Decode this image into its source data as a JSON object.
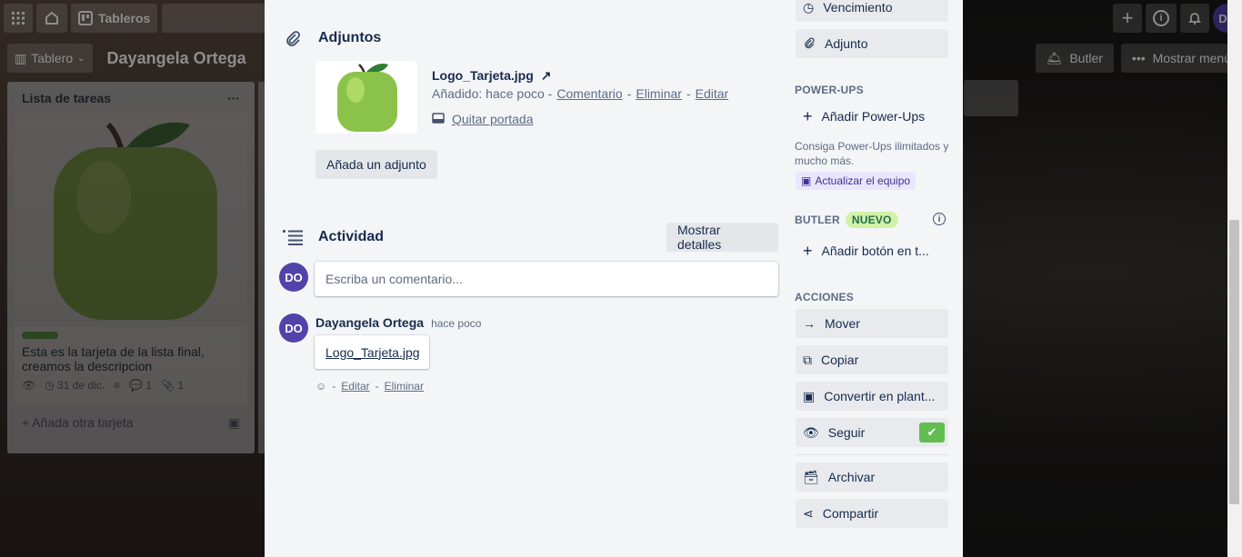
{
  "topbar": {
    "boards_label": "Tableros",
    "user_initials": "DO"
  },
  "boardbar": {
    "view_label": "Tablero",
    "board_title": "Dayangela Ortega",
    "butler_label": "Butler",
    "menu_label": "Mostrar menú"
  },
  "list": {
    "title": "Lista de tareas",
    "card": {
      "text": "Esta es la tarjeta de la lista final, creamos la descripcion",
      "due": "31 de dic.",
      "comments": "1",
      "attachments": "1"
    },
    "add_card": "Añada otra tarjeta"
  },
  "attachments": {
    "heading": "Adjuntos",
    "file_name": "Logo_Tarjeta.jpg",
    "arrow": "↗",
    "added_prefix": "Añadido: hace poco -",
    "comment_link": "Comentario",
    "delete_link": "Eliminar",
    "edit_link": "Editar",
    "sep": "-",
    "remove_cover": "Quitar portada",
    "add_button": "Añada un adjunto"
  },
  "activity": {
    "heading": "Actividad",
    "show_details": "Mostrar detalles",
    "comment_placeholder": "Escriba un comentario...",
    "avatar_initials": "DO",
    "entry": {
      "author": "Dayangela Ortega",
      "time": "hace poco",
      "attachment_link": "Logo_Tarjeta.jpg",
      "dash": "-",
      "edit": "Editar",
      "delete": "Eliminar"
    }
  },
  "sidebar": {
    "due_date": "Vencimiento",
    "attachment": "Adjunto",
    "powerups_heading": "POWER-UPS",
    "add_powerups": "Añadir Power-Ups",
    "powerups_note": "Consiga Power-Ups ilimitados y mucho más.",
    "upgrade_team": "Actualizar el equipo",
    "butler_heading": "BUTLER",
    "butler_badge": "NUEVO",
    "add_button": "Añadir botón en t...",
    "actions_heading": "ACCIONES",
    "move": "Mover",
    "copy": "Copiar",
    "convert": "Convertir en plant...",
    "follow": "Seguir",
    "archive": "Archivar",
    "share": "Compartir"
  },
  "colors": {
    "label_green": "#61bd4f",
    "avatar_purple": "#5243aa",
    "modal_bg": "#f4f5f7"
  }
}
